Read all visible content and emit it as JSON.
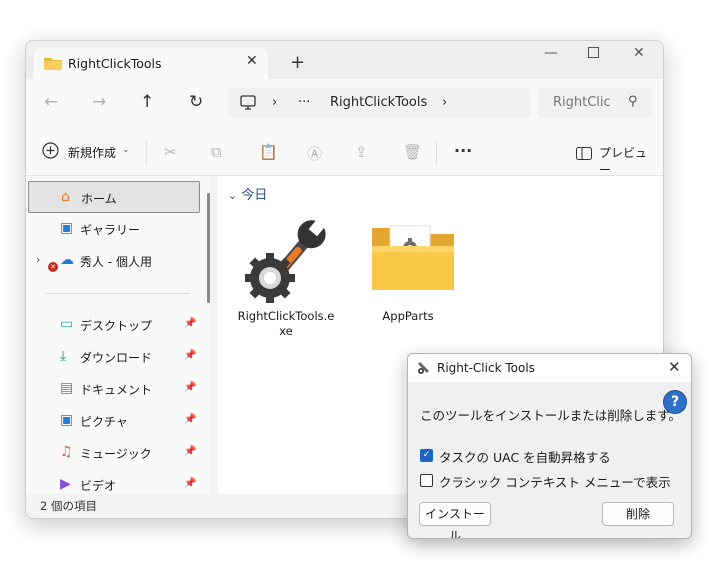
{
  "explorer": {
    "tab_title": "RightClickTools",
    "new_tab": "+",
    "address": {
      "ellipsis": "···",
      "path": "RightClickTools"
    },
    "search_placeholder": "RightClic",
    "toolbar": {
      "new_label": "新規作成",
      "more": "···",
      "preview_label": "プレビュー"
    },
    "sidebar": {
      "items": [
        {
          "label": "ホーム"
        },
        {
          "label": "ギャラリー"
        },
        {
          "label": "秀人 - 個人用"
        },
        {
          "label": "デスクトップ"
        },
        {
          "label": "ダウンロード"
        },
        {
          "label": "ドキュメント"
        },
        {
          "label": "ピクチャ"
        },
        {
          "label": "ミュージック"
        },
        {
          "label": "ビデオ"
        }
      ]
    },
    "group_title": "今日",
    "files": [
      {
        "name_line1": "RightClickTools.e",
        "name_line2": "xe"
      },
      {
        "name_line1": "AppParts",
        "name_line2": ""
      }
    ],
    "status": "2 個の項目"
  },
  "dialog": {
    "title": "Right-Click Tools",
    "message": "このツールをインストールまたは削除します。",
    "help": "?",
    "checkbox_uac": {
      "label": "タスクの UAC を自動昇格する",
      "checked": true
    },
    "checkbox_classic": {
      "label": "クラシック コンテキスト メニューで表示",
      "checked": false
    },
    "install_label": "インストール",
    "delete_label": "削除"
  }
}
